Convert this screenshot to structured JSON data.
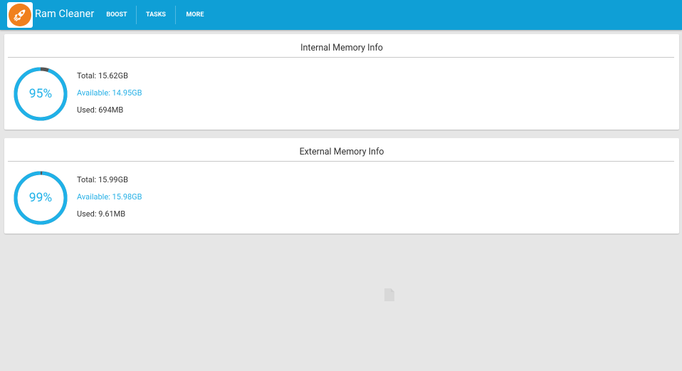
{
  "app": {
    "title": "Ram Cleaner",
    "logo_icon": "rocket-icon",
    "accent_color": "#0f9fd6"
  },
  "tabs": [
    {
      "label": "BOOST"
    },
    {
      "label": "TASKS"
    },
    {
      "label": "MORE"
    }
  ],
  "internal": {
    "title": "Internal Memory Info",
    "percent": 95,
    "percent_label": "95%",
    "total": "Total: 15.62GB",
    "available": "Available: 14.95GB",
    "used": "Used: 694MB"
  },
  "external": {
    "title": "External Memory Info",
    "percent": 99,
    "percent_label": "99%",
    "total": "Total: 15.99GB",
    "available": "Available: 15.98GB",
    "used": "Used: 9.61MB"
  },
  "colors": {
    "gauge_fill": "#1fb1e8",
    "gauge_used": "#555555",
    "available_text": "#26b0e6",
    "background": "#e6e6e6"
  },
  "icons": {
    "background_placeholder": "file-icon"
  }
}
